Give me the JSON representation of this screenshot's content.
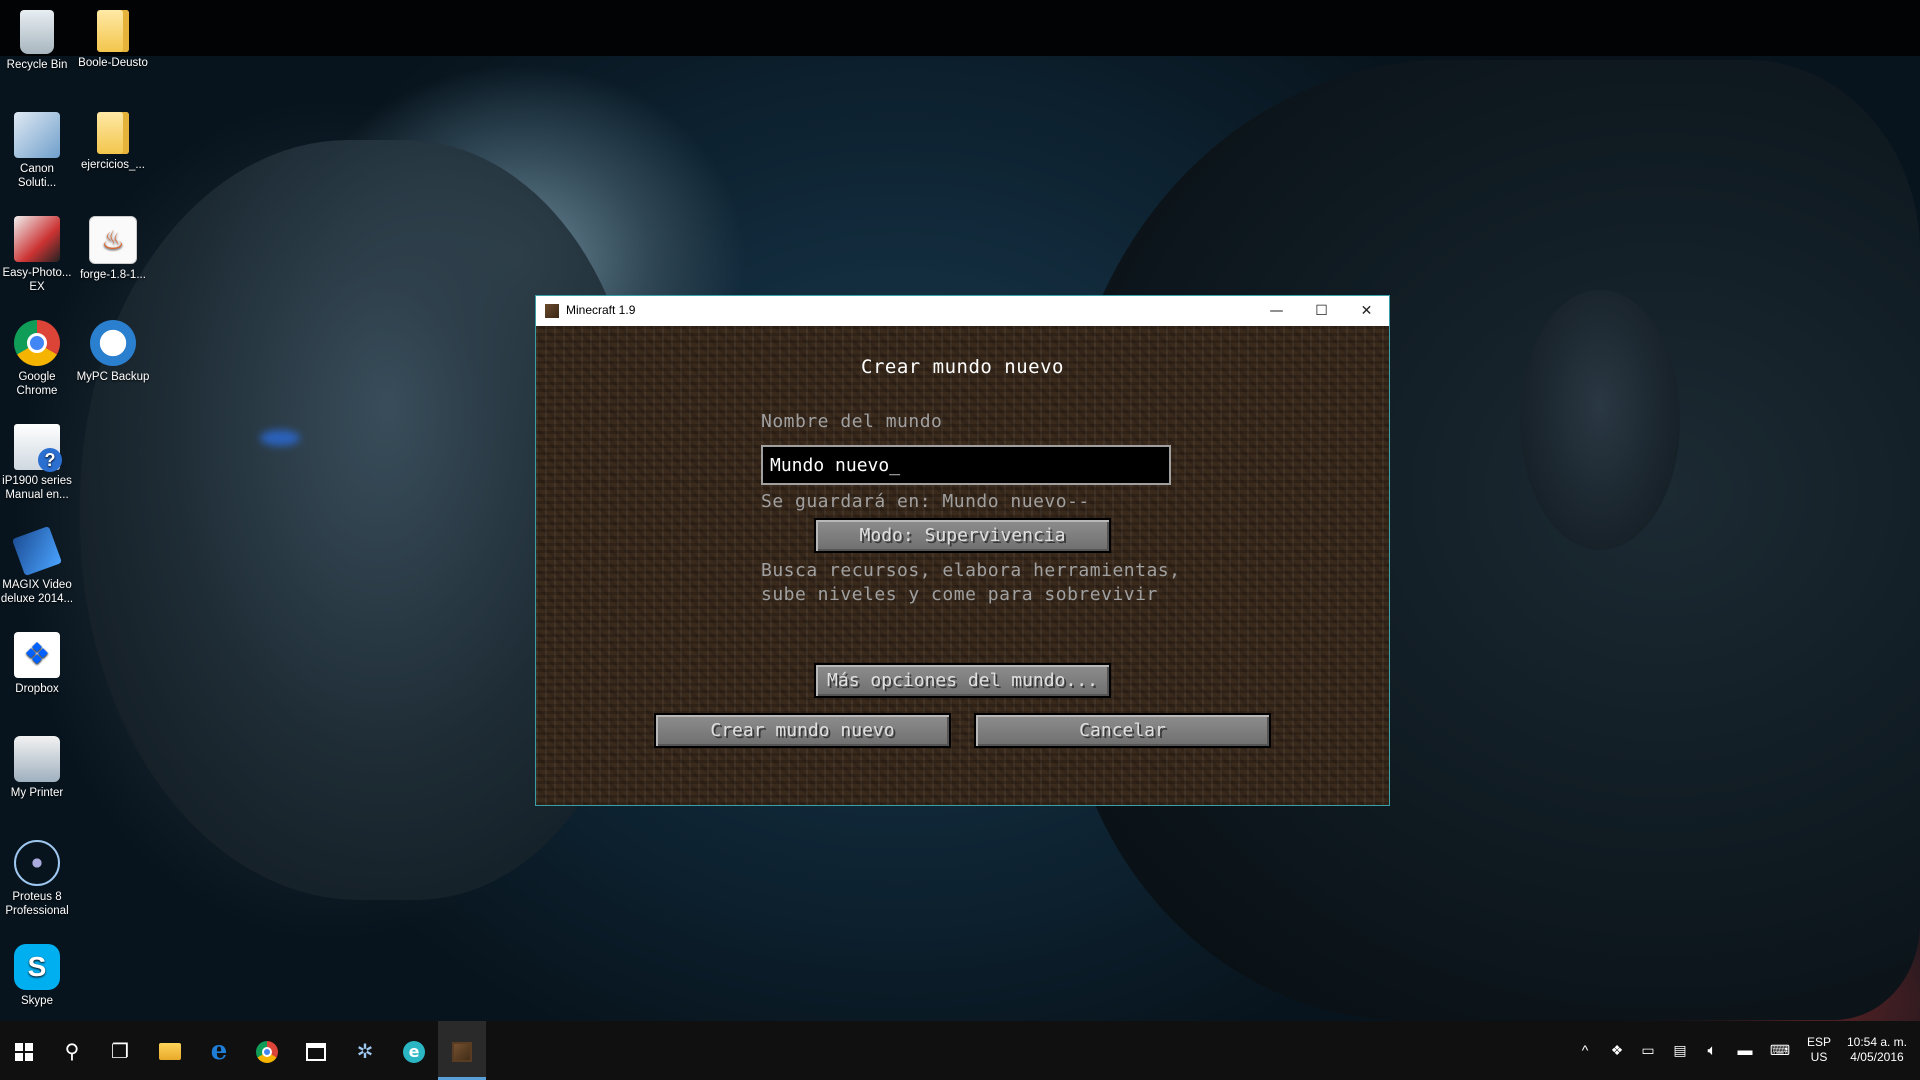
{
  "desktop": {
    "icons": [
      {
        "label": "Recycle Bin",
        "icon": "recycle-bin-icon"
      },
      {
        "label": "Boole-Deusto",
        "icon": "folder-icon"
      },
      {
        "label": "Canon Soluti...",
        "icon": "canon-solution-icon"
      },
      {
        "label": "ejercicios_...",
        "icon": "folder-icon"
      },
      {
        "label": "Easy-Photo... EX",
        "icon": "easy-photoprint-icon"
      },
      {
        "label": "forge-1.8-1...",
        "icon": "java-jar-icon"
      },
      {
        "label": "Google Chrome",
        "icon": "chrome-icon"
      },
      {
        "label": "MyPC Backup",
        "icon": "mypc-backup-icon"
      },
      {
        "label": "iP1900 series Manual en...",
        "icon": "manual-help-icon"
      },
      {
        "label": "MAGIX Video deluxe 2014...",
        "icon": "magix-video-icon"
      },
      {
        "label": "Dropbox",
        "icon": "dropbox-icon"
      },
      {
        "label": "My Printer",
        "icon": "printer-icon"
      },
      {
        "label": "Proteus 8 Professional",
        "icon": "proteus-icon"
      },
      {
        "label": "Skype",
        "icon": "skype-icon"
      }
    ]
  },
  "window": {
    "title": "Minecraft 1.9",
    "minimize_glyph": "—",
    "maximize_glyph": "☐",
    "close_glyph": "✕"
  },
  "minecraft": {
    "screen_title": "Crear mundo nuevo",
    "world_name_label": "Nombre del mundo",
    "world_name_value": "Mundo nuevo_",
    "save_location": "Se guardará en: Mundo nuevo--",
    "mode_button": "Modo: Supervivencia",
    "mode_description_line1": "Busca recursos, elabora herramientas,",
    "mode_description_line2": "sube niveles y come para sobrevivir",
    "more_options_button": "Más opciones del mundo...",
    "create_button": "Crear mundo nuevo",
    "cancel_button": "Cancelar"
  },
  "taskbar": {
    "items": [
      {
        "name": "start",
        "icon": "windows-logo-icon"
      },
      {
        "name": "search",
        "icon": "search-icon",
        "glyph": "⚲"
      },
      {
        "name": "task-view",
        "icon": "task-view-icon",
        "glyph": "❐"
      },
      {
        "name": "file-explorer",
        "icon": "folder-icon"
      },
      {
        "name": "edge",
        "icon": "edge-icon",
        "glyph": "e"
      },
      {
        "name": "chrome",
        "icon": "chrome-icon"
      },
      {
        "name": "store",
        "icon": "store-icon"
      },
      {
        "name": "proteus",
        "icon": "proteus-icon",
        "glyph": "✲"
      },
      {
        "name": "ie",
        "icon": "internet-explorer-icon",
        "glyph": "e"
      },
      {
        "name": "minecraft",
        "icon": "minecraft-icon",
        "active": true
      }
    ],
    "tray": {
      "chevron": "^",
      "language_top": "ESP",
      "language_bottom": "US",
      "time": "10:54 a. m.",
      "date": "4/05/2016"
    }
  }
}
